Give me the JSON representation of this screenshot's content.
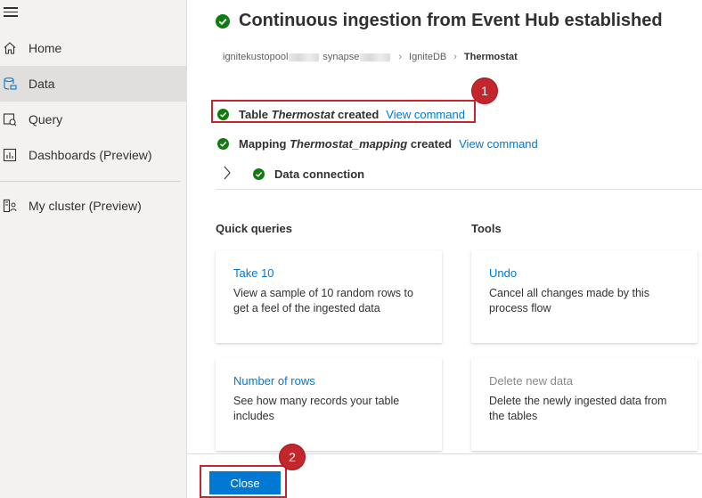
{
  "sidebar": {
    "items": [
      {
        "label": "Home",
        "icon": "home-icon"
      },
      {
        "label": "Data",
        "icon": "data-icon"
      },
      {
        "label": "Query",
        "icon": "query-icon"
      },
      {
        "label": "Dashboards (Preview)",
        "icon": "dashboards-icon"
      },
      {
        "label": "My cluster (Preview)",
        "icon": "cluster-icon"
      }
    ]
  },
  "header": {
    "title": "Continuous ingestion from Event Hub established"
  },
  "breadcrumb": {
    "part1": "ignitekustopool",
    "part2": "synapse",
    "database": "IgniteDB",
    "table": "Thermostat"
  },
  "status": {
    "table_prefix": "Table",
    "table_name": "Thermostat",
    "table_suffix": "created",
    "mapping_prefix": "Mapping",
    "mapping_name": "Thermostat_mapping",
    "mapping_suffix": "created",
    "view_command": "View command",
    "data_connection": "Data connection"
  },
  "badges": {
    "one": "1",
    "two": "2"
  },
  "quick_queries": {
    "title": "Quick queries",
    "cards": [
      {
        "title": "Take 10",
        "desc": "View a sample of 10 random rows to get a feel of the ingested data"
      },
      {
        "title": "Number of rows",
        "desc": "See how many records your table includes"
      }
    ]
  },
  "tools": {
    "title": "Tools",
    "cards": [
      {
        "title": "Undo",
        "desc": "Cancel all changes made by this process flow"
      },
      {
        "title": "Delete new data",
        "desc": "Delete the newly ingested data from the tables"
      }
    ]
  },
  "footer": {
    "close_label": "Close"
  },
  "colors": {
    "accent": "#0078d4",
    "success": "#107c10",
    "highlight": "#c4262e"
  }
}
